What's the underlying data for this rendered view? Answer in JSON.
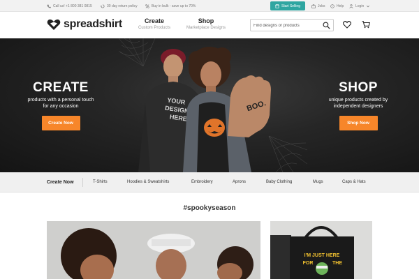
{
  "topbar": {
    "call": "Call us! +1 800 381 0815",
    "returns": "30 day return policy",
    "bulk": "Buy in bulk - save up to 70%",
    "start_selling": "Start Selling",
    "jobs": "Jobs",
    "help": "Help",
    "login": "Login"
  },
  "header": {
    "logo": "spreadshirt",
    "create_title": "Create",
    "create_sub": "Custom Products",
    "shop_title": "Shop",
    "shop_sub": "Marketplace Designs",
    "search_placeholder": "Find designs or products"
  },
  "hero": {
    "left_title": "CREATE",
    "left_sub1": "products with a personal touch",
    "left_sub2": "for any occasion",
    "left_button": "Create Now",
    "right_title": "SHOP",
    "right_sub1": "unique products created by",
    "right_sub2": "independent designers",
    "right_button": "Shop Now",
    "shirt_text_1": "YOUR",
    "shirt_text_2": "DESIGN",
    "shirt_text_3": "HERE",
    "hand_text": "BOO."
  },
  "categories": {
    "create_now": "Create Now",
    "items": [
      "T-Shirts",
      "Hoodies & Sweatshirts",
      "Embroidery",
      "Aprons",
      "Baby Clothing",
      "Mugs",
      "Caps & Hats"
    ]
  },
  "section": {
    "title": "#spookyseason",
    "bag_line1": "I'M JUST HERE",
    "bag_line2": "FOR",
    "bag_line3": "THE"
  },
  "colors": {
    "accent_orange": "#f7862a",
    "teal": "#2fa6a1",
    "hero_bg": "#1c1c1c"
  }
}
